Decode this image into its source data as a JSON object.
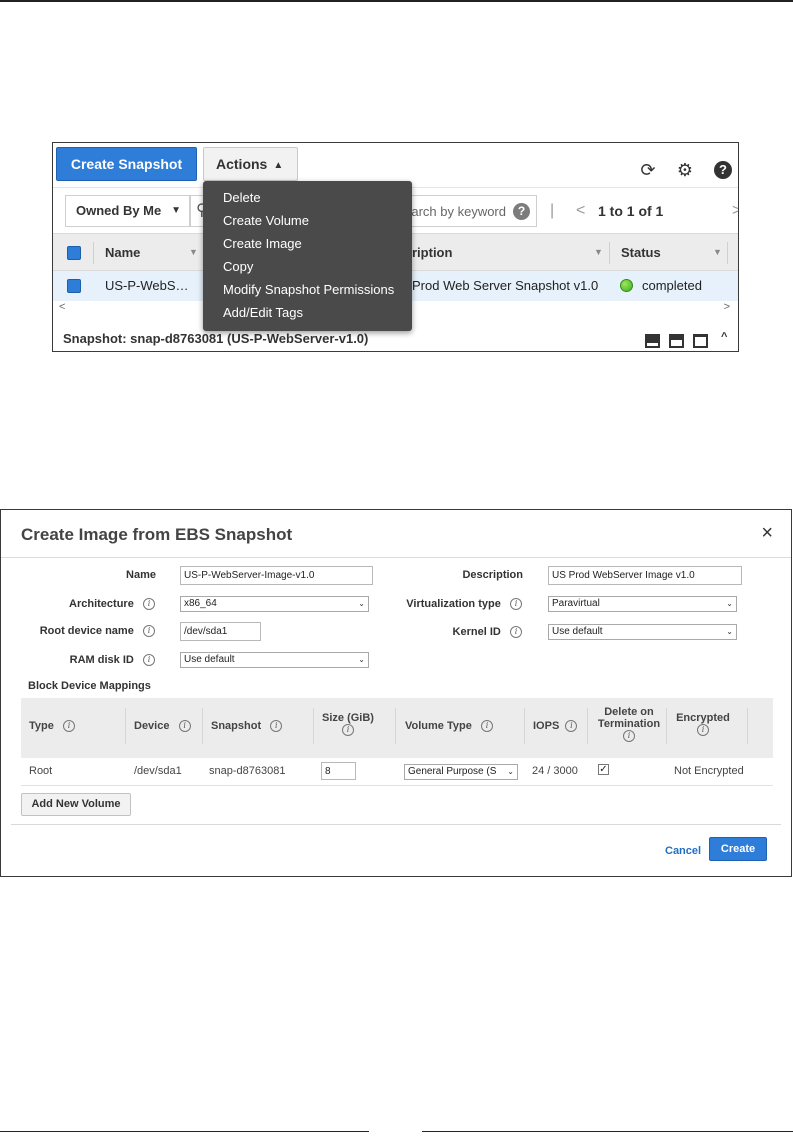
{
  "console": {
    "create_snapshot_label": "Create Snapshot",
    "actions_label": "Actions",
    "owned_by_label": "Owned By Me",
    "search_placeholder": "arch by keyword",
    "pager_text": "1 to 1 of 1",
    "columns": {
      "name": "Name",
      "description": "ription",
      "status": "Status"
    },
    "row": {
      "name": "US-P-WebS…",
      "description": "Prod Web Server Snapshot v1.0",
      "status": "completed"
    },
    "detail_label": "Snapshot: snap-d8763081 (US-P-WebServer-v1.0)",
    "status_color": "#3fae1f",
    "accent_color": "#2e7dd8"
  },
  "actions_menu": {
    "items": [
      "Delete",
      "Create Volume",
      "Create Image",
      "Copy",
      "Modify Snapshot Permissions",
      "Add/Edit Tags"
    ]
  },
  "dialog": {
    "title": "Create Image from EBS Snapshot",
    "close_icon": "×",
    "fields": {
      "name_label": "Name",
      "name_value": "US-P-WebServer-Image-v1.0",
      "description_label": "Description",
      "description_value": "US Prod WebServer Image v1.0",
      "architecture_label": "Architecture",
      "architecture_value": "x86_64",
      "virtualization_label": "Virtualization type",
      "virtualization_value": "Paravirtual",
      "root_device_label": "Root device name",
      "root_device_value": "/dev/sda1",
      "kernel_label": "Kernel ID",
      "kernel_value": "Use default",
      "ramdisk_label": "RAM disk ID",
      "ramdisk_value": "Use default"
    },
    "block_device": {
      "title": "Block Device Mappings",
      "headers": {
        "type": "Type",
        "device": "Device",
        "snapshot": "Snapshot",
        "size": "Size (GiB)",
        "volume_type": "Volume Type",
        "iops": "IOPS",
        "delete_line1": "Delete on",
        "delete_line2": "Termination",
        "encrypted": "Encrypted"
      },
      "row": {
        "type": "Root",
        "device": "/dev/sda1",
        "snapshot": "snap-d8763081",
        "size": "8",
        "volume_type": "General Purpose (S",
        "iops": "24 / 3000",
        "delete_on_termination": "✓",
        "encrypted": "Not Encrypted"
      }
    },
    "add_volume_label": "Add New Volume",
    "cancel_label": "Cancel",
    "create_label": "Create"
  }
}
